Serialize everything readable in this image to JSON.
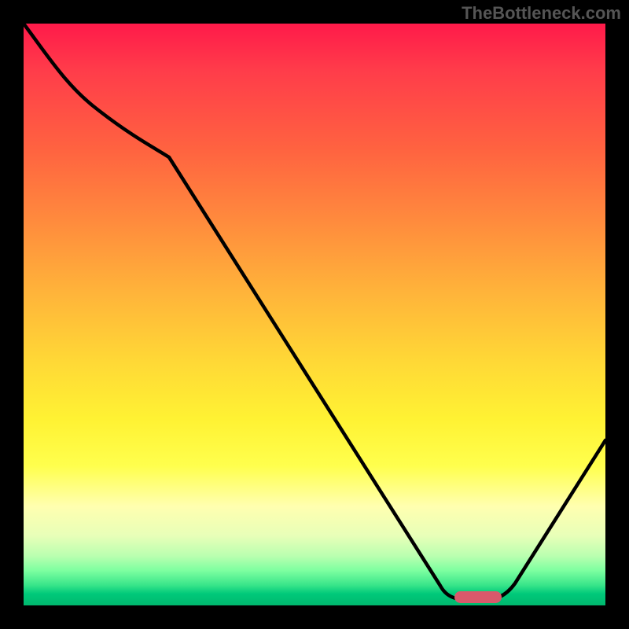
{
  "watermark": "TheBottleneck.com",
  "chart_data": {
    "type": "line",
    "title": "",
    "xlabel": "",
    "ylabel": "",
    "x_range": [
      0,
      100
    ],
    "y_range": [
      0,
      100
    ],
    "series": [
      {
        "name": "curve",
        "x": [
          0,
          8,
          25,
          70,
          75,
          80,
          100
        ],
        "y": [
          100,
          92,
          80,
          1,
          0,
          0,
          28
        ]
      }
    ],
    "marker": {
      "name": "optimal-range",
      "x_start": 74,
      "x_end": 80,
      "y": 1,
      "color": "#d9596b"
    },
    "gradient_stops": [
      {
        "pos": 0.0,
        "color": "#ff1a4a"
      },
      {
        "pos": 0.22,
        "color": "#ff6440"
      },
      {
        "pos": 0.46,
        "color": "#ffb33a"
      },
      {
        "pos": 0.68,
        "color": "#fff233"
      },
      {
        "pos": 0.83,
        "color": "#ffffb0"
      },
      {
        "pos": 0.94,
        "color": "#7dffa0"
      },
      {
        "pos": 1.0,
        "color": "#00b86e"
      }
    ]
  }
}
